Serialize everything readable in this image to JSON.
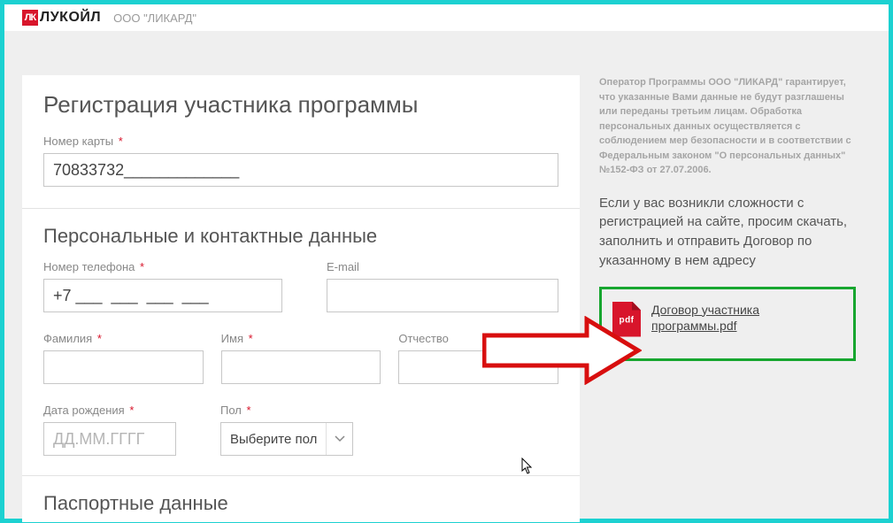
{
  "header": {
    "logo_mark": "ЛК",
    "logo_text": "ЛУКОЙЛ",
    "company": "ООО \"ЛИКАРД\""
  },
  "form": {
    "title": "Регистрация участника программы",
    "card": {
      "label": "Номер карты",
      "value": "70833732_____________"
    },
    "section_personal": "Персональные и контактные данные",
    "phone": {
      "label": "Номер телефона",
      "value": "+7 ___  ___  ___  ___"
    },
    "email": {
      "label": "E-mail",
      "value": ""
    },
    "lastname": {
      "label": "Фамилия",
      "value": ""
    },
    "firstname": {
      "label": "Имя",
      "value": ""
    },
    "patronym": {
      "label": "Отчество",
      "value": ""
    },
    "birthdate": {
      "label": "Дата рождения",
      "placeholder": "ДД.ММ.ГГГГ"
    },
    "gender": {
      "label": "Пол",
      "placeholder": "Выберите пол"
    },
    "section_passport": "Паспортные данные"
  },
  "sidebar": {
    "disclaimer": "Оператор Программы ООО \"ЛИКАРД\" гарантирует, что указанные Вами данные не будут разглашены или переданы третьим лицам. Обработка персональных данных осуществляется с соблюдением мер безопасности и в соответствии с Федеральным законом \"О персональных данных\" №152-ФЗ от 27.07.2006.",
    "help": "Если у вас возникли сложности с регистрацией на сайте, просим скачать, заполнить и отправить Договор по указанному в нем адресу",
    "pdf": {
      "icon_label": "pdf",
      "link_text": "Договор участника программы.pdf"
    }
  }
}
